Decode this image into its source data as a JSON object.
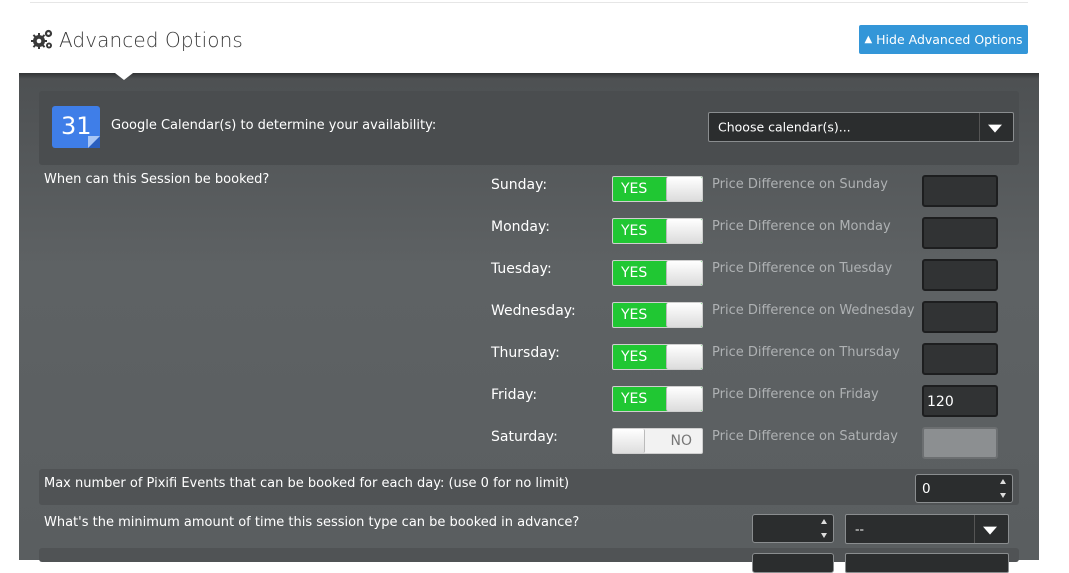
{
  "header": {
    "title": "Advanced Options",
    "hide_button": "Hide Advanced Options",
    "icon": "gears-icon"
  },
  "calendar": {
    "label": "Google Calendar(s) to determine your availability:",
    "icon_day": "31",
    "select_value": "Choose calendar(s)..."
  },
  "when_label": "When can this Session be booked?",
  "days": [
    {
      "day": "Sunday:",
      "toggle": "YES",
      "enabled": true,
      "price_label": "Price Difference on Sunday",
      "price": ""
    },
    {
      "day": "Monday:",
      "toggle": "YES",
      "enabled": true,
      "price_label": "Price Difference on Monday",
      "price": ""
    },
    {
      "day": "Tuesday:",
      "toggle": "YES",
      "enabled": true,
      "price_label": "Price Difference on Tuesday",
      "price": ""
    },
    {
      "day": "Wednesday:",
      "toggle": "YES",
      "enabled": true,
      "price_label": "Price Difference on Wednesday",
      "price": ""
    },
    {
      "day": "Thursday:",
      "toggle": "YES",
      "enabled": true,
      "price_label": "Price Difference on Thursday",
      "price": ""
    },
    {
      "day": "Friday:",
      "toggle": "YES",
      "enabled": true,
      "price_label": "Price Difference on Friday",
      "price": "120"
    },
    {
      "day": "Saturday:",
      "toggle": "NO",
      "enabled": false,
      "price_label": "Price Difference on Saturday",
      "price": ""
    }
  ],
  "max_events": {
    "label": "Max number of Pixifi Events that can be booked for each day: (use 0 for no limit)",
    "value": "0"
  },
  "min_advance": {
    "label": "What's the minimum amount of time this session type can be booked in advance?",
    "amount": "",
    "unit": "--"
  },
  "colors": {
    "accent": "#3396d8",
    "toggle_on": "#20c733",
    "panel": "#5e6264"
  }
}
